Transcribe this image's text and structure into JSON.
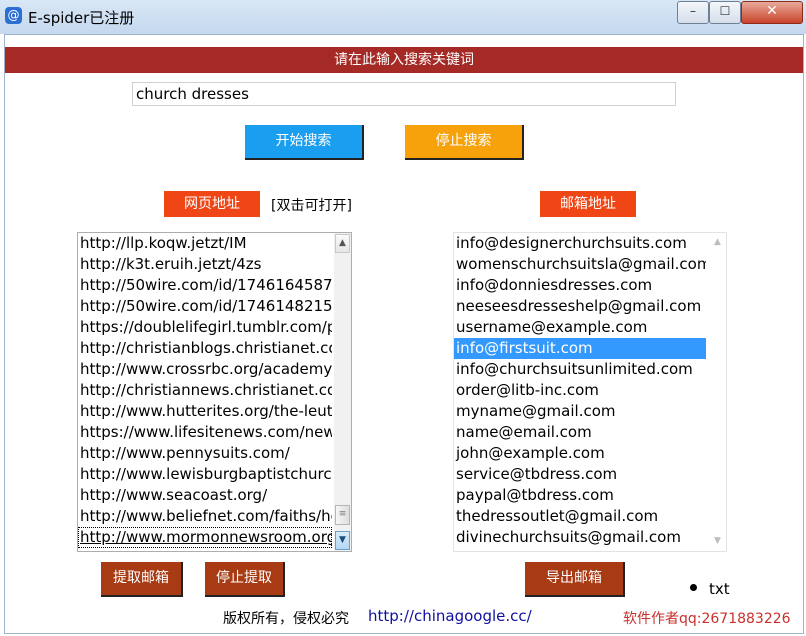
{
  "window": {
    "title": "E-spider已注册",
    "icon": "at-sign-icon",
    "controls": {
      "minimize": "minimize-icon",
      "maximize": "maximize-icon",
      "close": "close-icon"
    }
  },
  "header": {
    "banner": "请在此输入搜索关键词"
  },
  "search": {
    "value": "church dresses"
  },
  "buttons": {
    "start_search": "开始搜索",
    "stop_search": "停止搜索",
    "extract_email": "提取邮箱",
    "stop_extract": "停止提取",
    "export_email": "导出邮箱"
  },
  "labels": {
    "url_tag": "网页地址",
    "url_hint": "[双击可打开]",
    "email_tag": "邮箱地址"
  },
  "url_list": [
    "http://llp.koqw.jetzt/IM",
    "http://k3t.eruih.jetzt/4zs",
    "http://50wire.com/id/1746164587",
    "http://50wire.com/id/1746148215",
    "https://doublelifegirl.tumblr.com/p",
    "http://christianblogs.christianet.co",
    "http://www.crossrbc.org/academy",
    "http://christiannews.christianet.cor",
    "http://www.hutterites.org/the-leut",
    "https://www.lifesitenews.com/new",
    "http://www.pennysuits.com/",
    "http://www.lewisburgbaptistchurch",
    "http://www.seacoast.org/",
    "http://www.beliefnet.com/faiths/he",
    "http://www.mormonnewsroom.org"
  ],
  "email_list": [
    "info@designerchurchsuits.com",
    "womenschurchsuitsla@gmail.com",
    "info@donniesdresses.com",
    "neeseesdresseshelp@gmail.com",
    "username@example.com",
    "info@firstsuit.com",
    "info@churchsuitsunlimited.com",
    "order@litb-inc.com",
    "myname@gmail.com",
    "name@email.com",
    "john@example.com",
    "service@tbdress.com",
    "paypal@tbdress.com",
    "thedressoutlet@gmail.com",
    "divinechurchsuits@gmail.com"
  ],
  "email_selected_index": 5,
  "export_format": {
    "label": "txt",
    "selected": true
  },
  "footer": {
    "copyright": "版权所有，侵权必究",
    "link": "http://chinagoogle.cc/",
    "author": "软件作者qq:2671883226"
  },
  "colors": {
    "banner": "#a52a25",
    "start_button": "#1a9ef0",
    "stop_button": "#f7a20a",
    "tag": "#f04616",
    "action_button": "#a83b14",
    "selection": "#3399ff"
  }
}
